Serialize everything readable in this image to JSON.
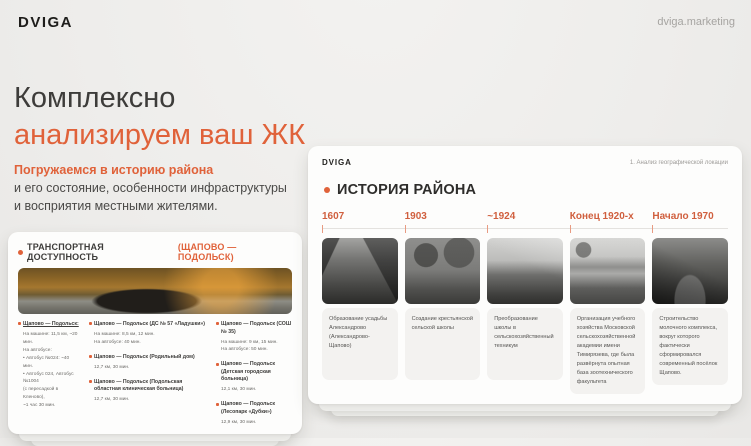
{
  "page": {
    "brand": "DVIGA",
    "site": "dviga.marketing",
    "title_line1": "Комплексно",
    "title_line2": "анализируем ваш ЖК",
    "intro_highlight": "Погружаемся в историю района",
    "intro_rest": "и его состояние, особенности инфраструктуры\nи восприятия местными жителями."
  },
  "icons": {
    "bullet": "orange-dot",
    "location_pin": "orange-pin"
  },
  "colors": {
    "accent": "#E0623A",
    "dark_text": "#3D3C3A",
    "muted_text": "#9C9A97",
    "background": "#EEEDEB",
    "card": "#FDFDFC"
  },
  "transport_card": {
    "title": "ТРАНСПОРТНАЯ ДОСТУПНОСТЬ",
    "title_location": "(ЩАПОВО — ПОДОЛЬСК)",
    "columns": [
      {
        "blocks": [
          {
            "title": "Щапово — Подольск:",
            "details": "На машине: 11,5 км, ~20 мин.\nНа автобусе:\n• Автобус №024: ~40 мин.\n• Автобус 024, Автобус №1004\n(с пересадкой в Кленово),\n~1 час 30 мин."
          }
        ]
      },
      {
        "blocks": [
          {
            "title": "Щапово — Подольск (ДС № 57 «Ладушки»)",
            "details": "На машине: 8,5 км, 12 мин.\nНа автобусе: 40 мин."
          },
          {
            "title": "Щапово — Подольск (Родильный дом)",
            "details": "12,7 км, 30 мин."
          },
          {
            "title": "Щапово — Подольск (Подольская областная клиническая больница)",
            "details": "12,7 км, 30 мин."
          }
        ]
      },
      {
        "blocks": [
          {
            "title": "Щапово — Подольск (СОШ № 35)",
            "details": "На машине: 9 км, 15 мин.\nНа автобусе: 50 мин."
          },
          {
            "title": "Щапово — Подольск (Детская городская больница)",
            "details": "12,1 км, 30 мин."
          },
          {
            "title": "Щапово — Подольск (Лесопарк «Дубки»)",
            "details": "12,9 км, 30 мин."
          }
        ]
      }
    ]
  },
  "slide": {
    "brand": "DVIGA",
    "section_label": "1. Анализ географической локации",
    "title": "ИСТОРИЯ РАЙОНА",
    "timeline": [
      {
        "date": "1607",
        "desc": "Образование усадьбы Александрово (Александрово-Щапово)"
      },
      {
        "date": "1903",
        "desc": "Создание крестьянской сельской школы"
      },
      {
        "date": "~1924",
        "desc": "Преобразование школы в сельскохозяйственный техникум"
      },
      {
        "date": "Конец 1920-х",
        "desc": "Организация  учебного хозяйства Московской сельскохозяйственной академии имени Тимирязева, где была развёрнута опытная база зоотехнического факультета"
      },
      {
        "date": "Начало 1970",
        "desc": "Строительство молочного комплекса, вокруг которого фактически сформировался современный посёлок Щапово."
      }
    ]
  }
}
